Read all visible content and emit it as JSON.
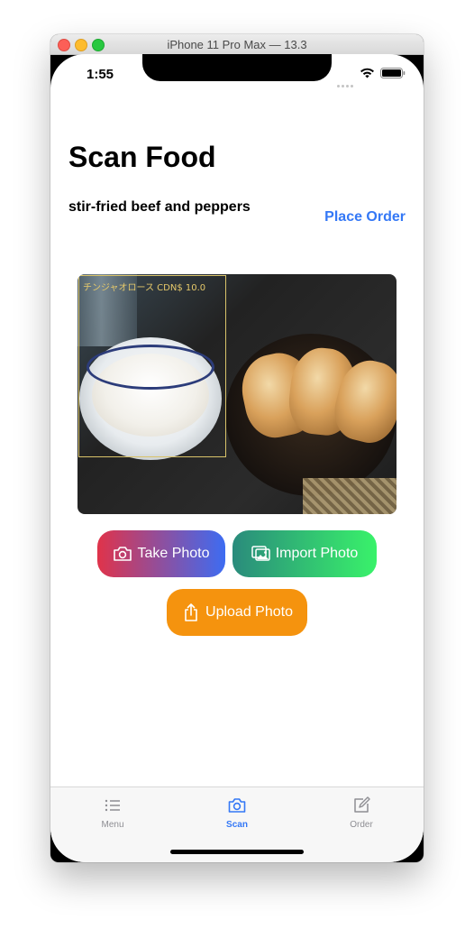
{
  "window": {
    "title": "iPhone 11 Pro Max — 13.3"
  },
  "status_bar": {
    "time": "1:55"
  },
  "header": {
    "title": "Scan Food"
  },
  "result": {
    "food_name": "stir-fried beef and peppers",
    "place_order_label": "Place Order"
  },
  "photo": {
    "detection_label": "チンジャオロース  CDN$ 10.0"
  },
  "buttons": {
    "take_photo": "Take Photo",
    "import_photo": "Import Photo",
    "upload_photo": "Upload Photo"
  },
  "tabs": [
    {
      "label": "Menu",
      "icon": "list-icon",
      "selected": false
    },
    {
      "label": "Scan",
      "icon": "camera-icon",
      "selected": true
    },
    {
      "label": "Order",
      "icon": "compose-icon",
      "selected": false
    }
  ],
  "colors": {
    "accent": "#3478f6",
    "tab_inactive": "#8e8e93",
    "upload": "#f5930e"
  }
}
